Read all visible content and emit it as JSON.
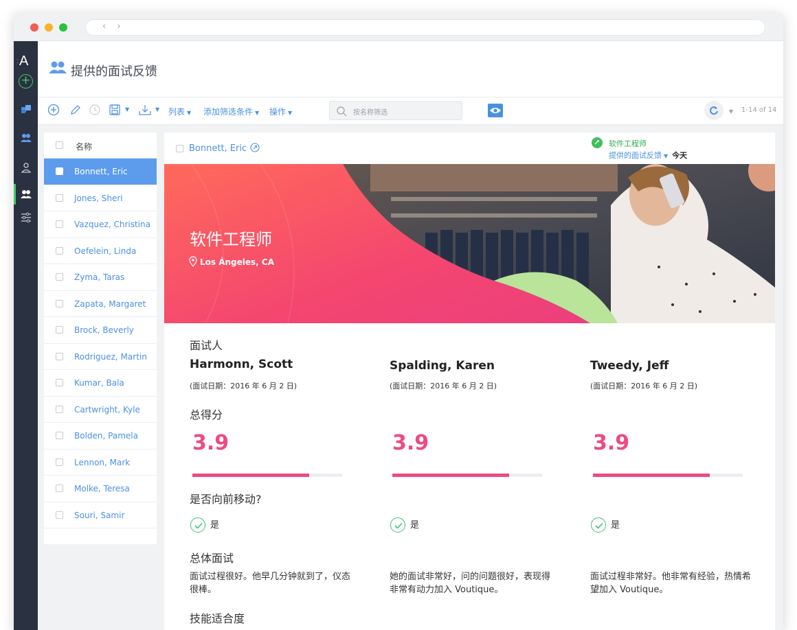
{
  "app": {
    "logo_letter": "A",
    "logo_prefix": ":"
  },
  "header": {
    "title": "提供的面试反馈"
  },
  "toolbar": {
    "list_label": "列表",
    "add_filter_label": "添加筛选条件",
    "actions_label": "操作",
    "search_placeholder": "按名称筛选",
    "pager": "1-14 of 14"
  },
  "list": {
    "header_label": "名称",
    "items": [
      "Bonnett, Eric",
      "Jones, Sheri",
      "Vazquez, Christina",
      "Oefelein, Linda",
      "Zyma, Taras",
      "Zapata, Margaret",
      "Brock, Beverly",
      "Rodriguez, Martin",
      "Kumar, Bala",
      "Cartwright, Kyle",
      "Bolden, Pamela",
      "Lennon, Mark",
      "Molke, Teresa",
      "Souri, Samir"
    ],
    "selected_index": 0
  },
  "detail": {
    "candidate_name": "Bonnett, Eric",
    "job_title": "软件工程师",
    "feedback_label": "提供的面试反馈",
    "feedback_when": "今天",
    "hero_title": "软件工程师",
    "hero_location": "Los Ángeles, CA",
    "interviewers_label": "面试人",
    "score_label": "总得分",
    "move_forward_label": "是否向前移动?",
    "overall_label": "总体面试",
    "skills_label": "技能适合度",
    "interviewers": [
      {
        "name": "Harmonn, Scott",
        "date": "(面试日期：2016 年 6 月 2 日)",
        "score": "3.9",
        "score_fraction": 0.78,
        "move_forward": "是",
        "comment": "面试过程很好。他早几分钟就到了，仪态很棒。"
      },
      {
        "name": "Spalding, Karen",
        "date": "(面试日期：2016 年 6 月 2 日)",
        "score": "3.9",
        "score_fraction": 0.78,
        "move_forward": "是",
        "comment": "她的面试非常好，问的问题很好，表现得非常有动力加入 Voutique。"
      },
      {
        "name": "Tweedy, Jeff",
        "date": "(面试日期：2016 年 6 月 2 日)",
        "score": "3.9",
        "score_fraction": 0.78,
        "move_forward": "是",
        "comment": "面试过程非常好。他非常有经验，热情希望加入 Voutique。"
      }
    ]
  },
  "colors": {
    "accent": "#4a90e2",
    "score": "#ee4a83",
    "success": "#3fbf5c",
    "sidebar": "#2a3140"
  }
}
